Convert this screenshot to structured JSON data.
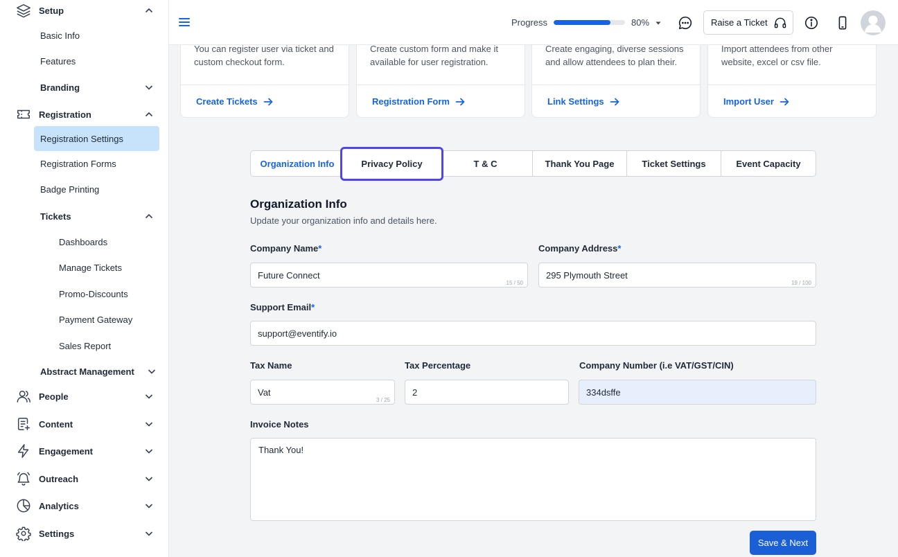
{
  "sidebar": {
    "setup": "Setup",
    "basic_info": "Basic Info",
    "features": "Features",
    "branding": "Branding",
    "registration": "Registration",
    "registration_settings": "Registration Settings",
    "registration_forms": "Registration Forms",
    "badge_printing": "Badge Printing",
    "tickets": "Tickets",
    "dashboards": "Dashboards",
    "manage_tickets": "Manage Tickets",
    "promo_discounts": "Promo-Discounts",
    "payment_gateway": "Payment Gateway",
    "sales_report": "Sales Report",
    "abstract_management": "Abstract Management",
    "people": "People",
    "content": "Content",
    "engagement": "Engagement",
    "outreach": "Outreach",
    "analytics": "Analytics",
    "settings": "Settings"
  },
  "header": {
    "progress_label": "Progress",
    "progress_value": 80,
    "progress_text": "80%",
    "raise_ticket": "Raise a Ticket"
  },
  "cards": [
    {
      "desc": "You can register user via ticket and custom checkout form.",
      "link": "Create Tickets"
    },
    {
      "desc": "Create custom form and make it available for user registration.",
      "link": "Registration Form"
    },
    {
      "desc": "Create engaging, diverse sessions and allow attendees to plan their.",
      "link": "Link Settings"
    },
    {
      "desc": "Import attendees from other website, excel or csv file.",
      "link": "Import User"
    }
  ],
  "tabs": {
    "organization_info": "Organization Info",
    "privacy_policy": "Privacy Policy",
    "tc": "T & C",
    "thank_you_page": "Thank You Page",
    "ticket_settings": "Ticket Settings",
    "event_capacity": "Event Capacity"
  },
  "form": {
    "title": "Organization Info",
    "subtitle": "Update your organization info and details here.",
    "required_mark": "*",
    "company_name_label": "Company Name",
    "company_name_value": "Future Connect",
    "company_name_counter": "15 / 50",
    "company_address_label": "Company Address",
    "company_address_value": "295 Plymouth Street",
    "company_address_counter": "19 / 100",
    "support_email_label": "Support Email",
    "support_email_value": "support@eventify.io",
    "tax_name_label": "Tax Name",
    "tax_name_value": "Vat",
    "tax_name_counter": "3 / 25",
    "tax_percentage_label": "Tax Percentage",
    "tax_percentage_value": "2",
    "company_number_label": "Company Number (i.e VAT/GST/CIN)",
    "company_number_value": "334dsffe",
    "invoice_notes_label": "Invoice Notes",
    "invoice_notes_value": "Thank You!",
    "save_button": "Save & Next"
  },
  "colors": {
    "accent": "#1565e0",
    "active_nav_bg": "#c7e3fb",
    "focus_ring": "#4f46e5",
    "filled_field_bg": "#e8effc"
  }
}
